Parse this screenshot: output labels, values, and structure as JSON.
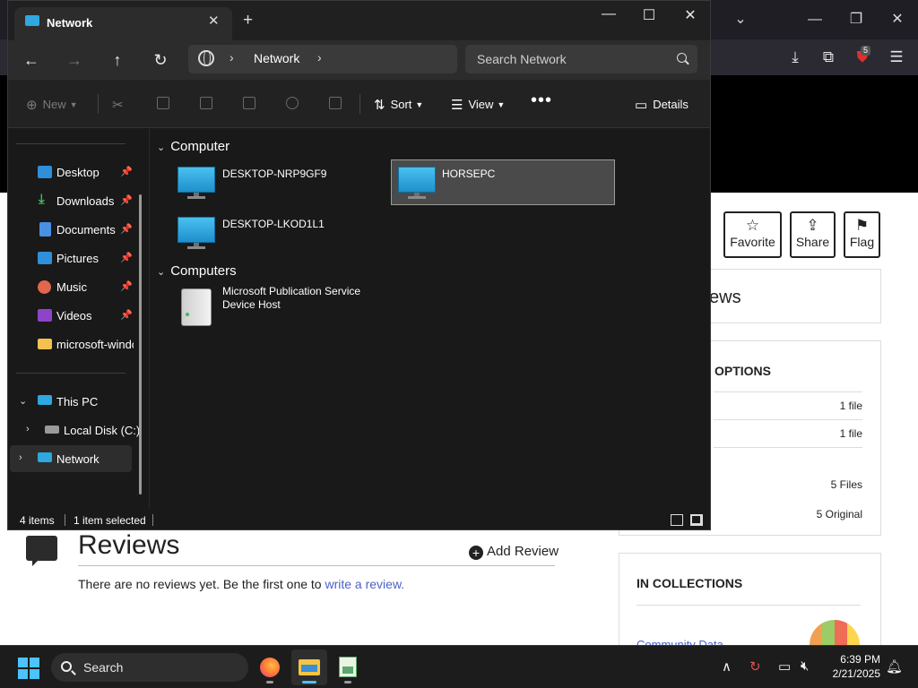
{
  "explorer": {
    "tab_title": "Network",
    "address": {
      "segment": "Network"
    },
    "search_placeholder": "Search Network",
    "commands": {
      "new": "New",
      "sort": "Sort",
      "view": "View",
      "details": "Details"
    },
    "nav": {
      "quick_access": [
        {
          "label": "Desktop",
          "icon": "desktop-icon"
        },
        {
          "label": "Downloads",
          "icon": "download-icon"
        },
        {
          "label": "Documents",
          "icon": "documents-icon"
        },
        {
          "label": "Pictures",
          "icon": "pictures-icon"
        },
        {
          "label": "Music",
          "icon": "music-icon"
        },
        {
          "label": "Videos",
          "icon": "videos-icon"
        },
        {
          "label": "microsoft-windo",
          "icon": "folder-icon"
        }
      ],
      "this_pc": "This PC",
      "local_disk": "Local Disk (C:)",
      "network": "Network"
    },
    "groups": [
      {
        "title": "Computer",
        "items": [
          "DESKTOP-NRP9GF9",
          "HORSEPC",
          "DESKTOP-LKOD1L1"
        ]
      },
      {
        "title": "Computers",
        "items": [
          "Microsoft Publication Service Device Host"
        ]
      }
    ],
    "selected_item": "HORSEPC",
    "status": {
      "count": "4 items",
      "selected": "1 item selected"
    }
  },
  "browser_page": {
    "actions": {
      "favorite": "Favorite",
      "share": "Share",
      "flag": "Flag"
    },
    "reviews_partial": "ews",
    "options_title": "OPTIONS",
    "options_rows": [
      "1 file",
      "1 file",
      "5 Files",
      "5 Original"
    ],
    "reviews_title": "Reviews",
    "add_review": "Add Review",
    "no_reviews_text": "There are no reviews yet. Be the first one to ",
    "write_review_link": "write a review.",
    "collections_title": "IN COLLECTIONS",
    "collections_link": "Community Data",
    "extension_badge": "5"
  },
  "taskbar": {
    "search": "Search",
    "time": "6:39 PM",
    "date": "2/21/2025"
  },
  "colors": {
    "accent": "#4cc2ff",
    "link": "#4b62c9",
    "explorer_bg": "#191919"
  }
}
